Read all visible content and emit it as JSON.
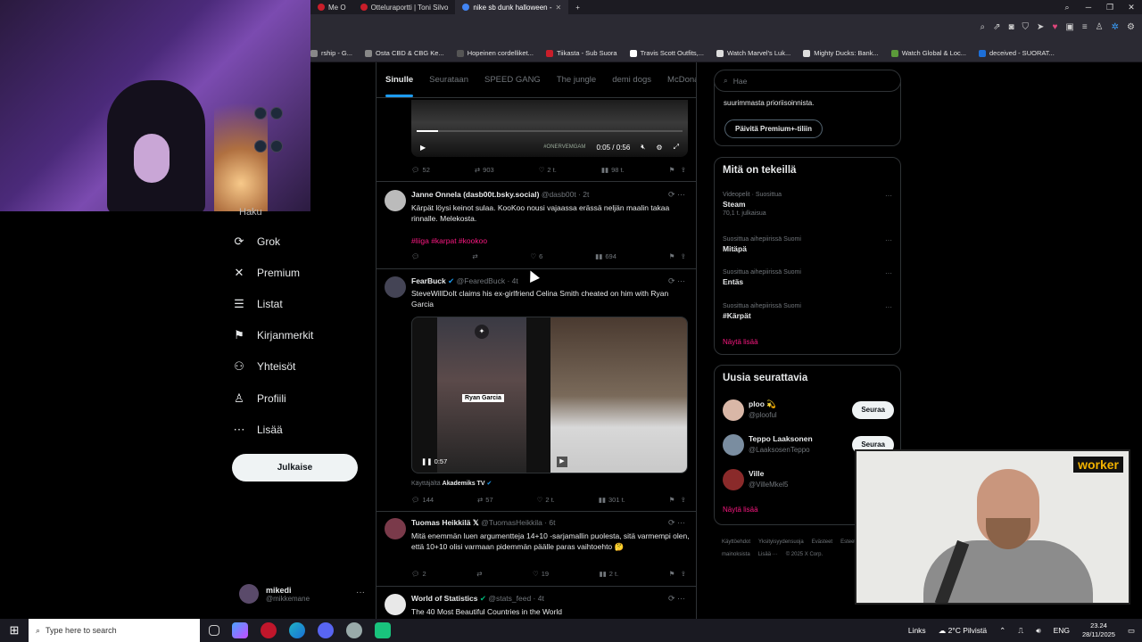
{
  "browser": {
    "tabs": [
      {
        "label": "Me O",
        "color": "#c91e2a",
        "active": false
      },
      {
        "label": "Otteluraportti | Toni Silvo",
        "color": "#c91e2a",
        "active": false
      },
      {
        "label": "nike sb dunk halloween - ",
        "color": "#4285f4",
        "active": true
      }
    ],
    "new_tab": "+",
    "bookmarks": [
      {
        "label": "rship - G...",
        "color": "#888"
      },
      {
        "label": "Osta CBD & CBG Ke...",
        "color": "#888"
      },
      {
        "label": "Hopeinen cordelliket...",
        "color": "#555"
      },
      {
        "label": "Tiikasta - Sub Suora",
        "color": "#c91e2a"
      },
      {
        "label": "Travis Scott Outfits,...",
        "color": "#fff"
      },
      {
        "label": "Watch Marvel's Luk...",
        "color": "#ddd"
      },
      {
        "label": "Mighty Ducks: Bank...",
        "color": "#ddd"
      },
      {
        "label": "Watch Global & Loc...",
        "color": "#5b9a3a"
      },
      {
        "label": "deceived - SUORAT...",
        "color": "#1d6fd8"
      }
    ]
  },
  "sidebar": {
    "partial_item": "Haku",
    "items": [
      {
        "label": "Grok",
        "icon": "grok-icon",
        "glyph": "⟳"
      },
      {
        "label": "Premium",
        "icon": "x-logo-icon",
        "glyph": "✕"
      },
      {
        "label": "Listat",
        "icon": "list-icon",
        "glyph": "☰"
      },
      {
        "label": "Kirjanmerkit",
        "icon": "bookmark-icon",
        "glyph": "⚑"
      },
      {
        "label": "Yhteisöt",
        "icon": "communities-icon",
        "glyph": "⚇"
      },
      {
        "label": "Profiili",
        "icon": "profile-icon",
        "glyph": "♙"
      },
      {
        "label": "Lisää",
        "icon": "more-circle-icon",
        "glyph": "⋯"
      }
    ],
    "post_button": "Julkaise",
    "account": {
      "name": "mikedi",
      "handle": "@mikkemane"
    }
  },
  "timeline": {
    "tabs": [
      "Sinulle",
      "Seurataan",
      "SPEED GANG",
      "The jungle",
      "demi dogs",
      "McDonalds"
    ],
    "video1": {
      "time": "0:05 / 0:56",
      "watermark": "#ONERVEMGAM",
      "replies": "52",
      "reposts": "903",
      "likes": "2 t.",
      "views": "98 t."
    },
    "tweets": [
      {
        "name": "Janne Onnela (dasb00t.bsky.social)",
        "handle": "@dasb00t · 2t",
        "text": "Kärpät löysi keinot sulaa. KooKoo nousi vajaassa erässä neljän maalin takaa rinnalle. Melekosta.",
        "tags": "#liiga #karpat #kookoo",
        "replies": "",
        "reposts": "",
        "likes": "6",
        "views": "694"
      },
      {
        "name": "FearBuck",
        "handle": "@FearedBuck · 4t",
        "text": "SteveWillDoIt claims his ex-girlfriend Celina Smith cheated on him with Ryan Garcia",
        "video_label": "Ryan Garcia",
        "video_time": "0:57",
        "from_label": "Käyttäjältä",
        "from_account": "Akademiks TV",
        "replies": "144",
        "reposts": "57",
        "likes": "2 t.",
        "views": "301 t."
      },
      {
        "name": "Tuomas Heikkilä",
        "handle": "@TuomasHeikkila · 6t",
        "text": "Mitä enemmän luen argumentteja 14+10 -sarjamallin puolesta, sitä varmempi olen, että 10+10 olisi varmaan pidemmän päälle paras vaihtoehto 🤔",
        "replies": "2",
        "reposts": "",
        "likes": "19",
        "views": "2 t."
      },
      {
        "name": "World of Statistics",
        "handle": "@stats_feed · 4t",
        "text": "The 40 Most Beautiful Countries in the World"
      }
    ]
  },
  "right": {
    "search_placeholder": "Hae",
    "premium_text": "suurimmasta prioriisoinnista.",
    "premium_button": "Päivitä Premium+-tiliin",
    "trends_title": "Mitä on tekeillä",
    "trends": [
      {
        "context": "Videopelit · Suosittua",
        "title": "Steam",
        "count": "70,1 t. julkaisua"
      },
      {
        "context": "Suosittua aihepiirissä Suomi",
        "title": "Mitäpä",
        "count": ""
      },
      {
        "context": "Suosittua aihepiirissä Suomi",
        "title": "Entäs",
        "count": ""
      },
      {
        "context": "Suosittua aihepiirissä Suomi",
        "title": "#Kärpät",
        "count": ""
      }
    ],
    "show_more": "Näytä lisää",
    "follow_title": "Uusia seurattavia",
    "follow": [
      {
        "name": "ploo 💫",
        "handle": "@plooful",
        "button": "Seuraa"
      },
      {
        "name": "Teppo Laaksonen",
        "handle": "@LaaksosenTeppo",
        "button": "Seuraa"
      },
      {
        "name": "Ville",
        "handle": "@VilleMkel5",
        "button": ""
      }
    ],
    "footer": [
      "Käyttöehdot",
      "Yksityisyydensuoja",
      "Evästeet",
      "Esteettömyys",
      "Tietoa mainoksista",
      "Lisää ···",
      "© 2025 X Corp."
    ]
  },
  "webcam": {
    "badge": "worker"
  },
  "taskbar": {
    "search_placeholder": "Type here to search",
    "links": "Links",
    "weather": "2°C  Pilvistä",
    "lang": "ENG",
    "time": "23.24",
    "date": "28/11/2025"
  }
}
